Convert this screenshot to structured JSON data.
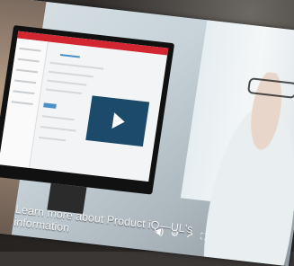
{
  "video": {
    "caption": "Learn more about Product iQ—UL's",
    "caption_line2": "information",
    "app_bar_label": "",
    "controls": {
      "volume_icon": "volume-icon",
      "settings_icon": "gear-icon",
      "share_icon": "share-icon",
      "fullscreen_icon": "fullscreen-icon"
    }
  },
  "colors": {
    "app_bar": "#d22630",
    "play_button": "#1b4a6b"
  }
}
